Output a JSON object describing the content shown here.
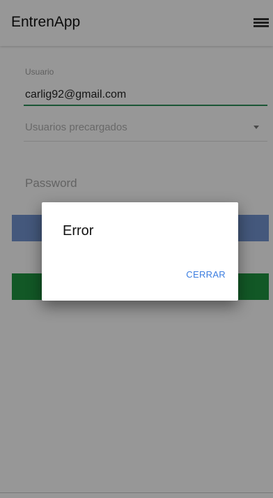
{
  "appbar": {
    "title": "EntrenApp",
    "menu_icon": "menu-icon"
  },
  "login_form": {
    "user_label": "Usuario",
    "email_value": "carlig92@gmail.com",
    "preloaded_users_select": "Usuarios precargados",
    "password_placeholder": "Password"
  },
  "dialog": {
    "title": "Error",
    "close_button": "CERRAR"
  },
  "colors": {
    "accent_green": "#1e8f3e",
    "button_blue": "#6f8fc8",
    "link_blue": "#3b7de0"
  }
}
